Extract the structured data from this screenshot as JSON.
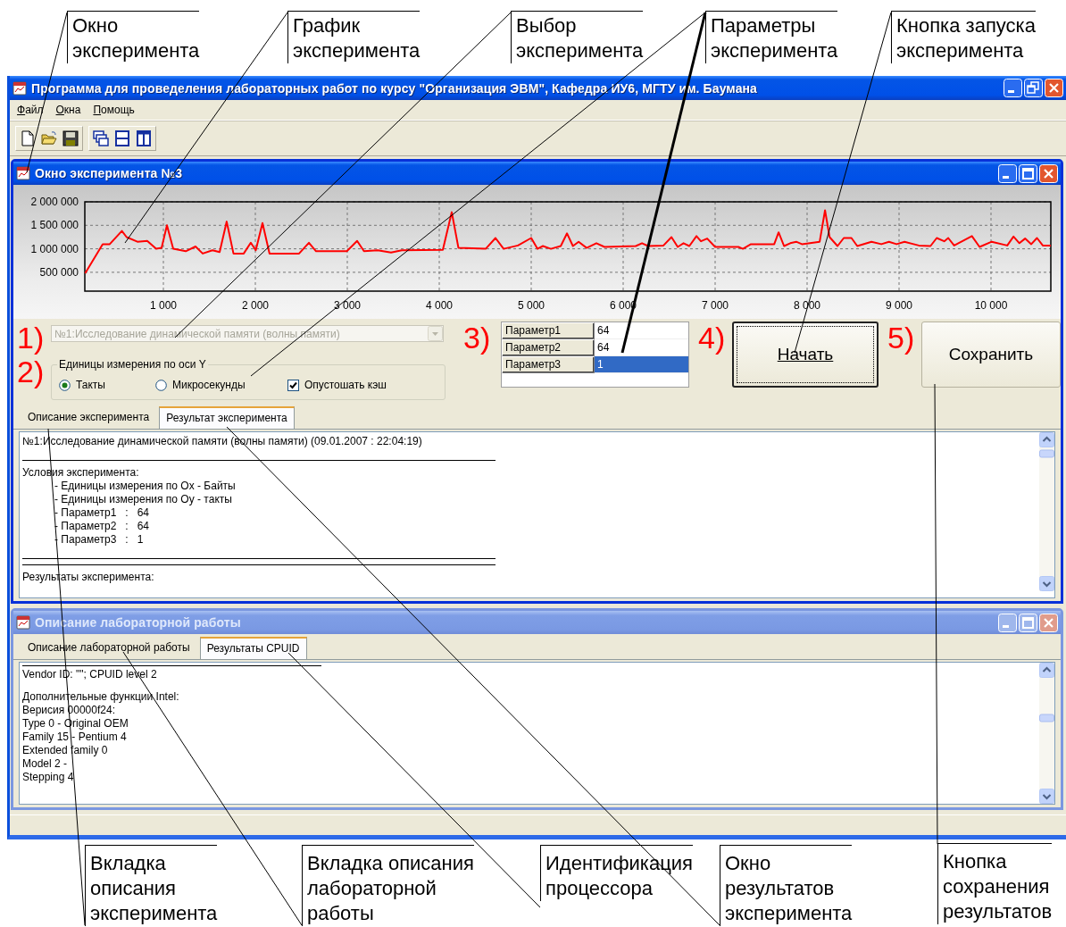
{
  "callouts_top": [
    {
      "text": "Окно\nэксперимента"
    },
    {
      "text": "График\nэксперимента"
    },
    {
      "text": "Выбор\nэксперимента"
    },
    {
      "text": "Параметры\nэксперимента"
    },
    {
      "text": "Кнопка запуска\nэксперимента"
    }
  ],
  "window": {
    "title": "Программа для проведеления лабораторных работ по курсу \"Организация ЭВМ\", Кафедра ИУ6, МГТУ им. Баумана",
    "active": true
  },
  "menu": [
    {
      "label": "Файл",
      "mnemonic": true
    },
    {
      "label": "Окна",
      "mnemonic": true
    },
    {
      "label": "Помощь",
      "mnemonic": true
    }
  ],
  "experiment_window": {
    "title": "Окно эксперимента №3",
    "active": true,
    "chart_data": {
      "type": "line",
      "grid": true,
      "xlim": [
        146,
        10650
      ],
      "ylim": [
        100000,
        2000000
      ],
      "xticks": [
        {
          "value": 1000,
          "label": "1 000"
        },
        {
          "value": 2000,
          "label": "2 000"
        },
        {
          "value": 3000,
          "label": "3 000"
        },
        {
          "value": 4000,
          "label": "4 000"
        },
        {
          "value": 5000,
          "label": "5 000"
        },
        {
          "value": 6000,
          "label": "6 000"
        },
        {
          "value": 7000,
          "label": "7 000"
        },
        {
          "value": 8000,
          "label": "8 000"
        },
        {
          "value": 9000,
          "label": "9 000"
        },
        {
          "value": 10000,
          "label": "10 000"
        }
      ],
      "yticks": [
        {
          "value": 500000,
          "label": "500 000"
        },
        {
          "value": 1000000,
          "label": "1 000 000"
        },
        {
          "value": 1500000,
          "label": "1 500 000"
        },
        {
          "value": 2000000,
          "label": "2 000 000"
        }
      ],
      "x": [
        150,
        340,
        417,
        549,
        600,
        718,
        825,
        922,
        981,
        1039,
        1107,
        1243,
        1350,
        1427,
        1534,
        1612,
        1689,
        1762,
        1874,
        1951,
        2005,
        2078,
        2155,
        2359,
        2476,
        2583,
        2660,
        2995,
        3107,
        3182,
        3330,
        3476,
        3592,
        4039,
        4136,
        4209,
        4505,
        4612,
        4700,
        4855,
        5000,
        5068,
        5127,
        5214,
        5321,
        5389,
        5453,
        5515,
        5603,
        5709,
        5797,
        6137,
        6205,
        6272,
        6438,
        6525,
        6593,
        6656,
        6719,
        6797,
        6845,
        6913,
        7000,
        7253,
        7302,
        7389,
        7642,
        7690,
        7749,
        7817,
        7881,
        7943,
        8137,
        8195,
        8244,
        8331,
        8399,
        8482,
        8545,
        8700,
        8807,
        8890,
        8972,
        9060,
        9215,
        9341,
        9409,
        9491,
        9535,
        9599,
        9792,
        9875,
        10007,
        10176,
        10244,
        10308,
        10370,
        10437,
        10500,
        10563,
        10650
      ],
      "series": [
        {
          "color": "#ff0000",
          "values": [
            480000,
            1100000,
            1100000,
            1380000,
            1250000,
            1150000,
            1170000,
            1000000,
            1020000,
            1500000,
            1000000,
            950000,
            1050000,
            900000,
            970000,
            930000,
            1580000,
            900000,
            900000,
            1130000,
            970000,
            1550000,
            900000,
            900000,
            900000,
            1130000,
            950000,
            950000,
            1170000,
            950000,
            970000,
            920000,
            970000,
            980000,
            1780000,
            1020000,
            1000000,
            1230000,
            1000000,
            1070000,
            1230000,
            1000000,
            1060000,
            1000000,
            1060000,
            1330000,
            1060000,
            1150000,
            1020000,
            1120000,
            1040000,
            1060000,
            1120000,
            1060000,
            1070000,
            1250000,
            1040000,
            1120000,
            1060000,
            1270000,
            1160000,
            1220000,
            1040000,
            1040000,
            1000000,
            1100000,
            1100000,
            1350000,
            1060000,
            1120000,
            1150000,
            1100000,
            1150000,
            1820000,
            1250000,
            1060000,
            1230000,
            1230000,
            1060000,
            1150000,
            1100000,
            1150000,
            1100000,
            1150000,
            1070000,
            1060000,
            1230000,
            1160000,
            1230000,
            1070000,
            1270000,
            1040000,
            1150000,
            1070000,
            1260000,
            1120000,
            1220000,
            1100000,
            1230000,
            1070000,
            1070000
          ]
        }
      ]
    },
    "markers": [
      "1)",
      "2)",
      "3)",
      "4)",
      "5)"
    ],
    "experiment_select": {
      "value": "№1:Исследование динамической памяти (волны памяти)",
      "disabled": true
    },
    "units_group": {
      "title": "Единицы измерения по оси Y",
      "options": [
        {
          "label": "Такты",
          "selected": true
        },
        {
          "label": "Микросекунды",
          "selected": false
        }
      ]
    },
    "clear_cache": {
      "label": "Опустошать кэш",
      "checked": true
    },
    "parameters": [
      {
        "name": "Параметр1",
        "value": "64",
        "selected": false
      },
      {
        "name": "Параметр2",
        "value": "64",
        "selected": false
      },
      {
        "name": "Параметр3",
        "value": "1",
        "selected": true
      }
    ],
    "start_button": {
      "label": "Начать",
      "default": true
    },
    "save_button": {
      "label": "Сохранить",
      "default": false
    },
    "tabs": [
      {
        "label": "Описание эксперимента",
        "selected": false
      },
      {
        "label": "Результат эксперимента",
        "selected": true
      }
    ],
    "text_lines": [
      {
        "kind": "text",
        "text": "№1:Исследование динамической памяти (волны памяти) (09.01.2007 : 22:04:19)"
      },
      {
        "kind": "gap"
      },
      {
        "kind": "rule"
      },
      {
        "kind": "text",
        "text": "Условия эксперимента:"
      },
      {
        "kind": "item",
        "text": "- Единицы измерения по Ox - Байты"
      },
      {
        "kind": "item",
        "text": "- Единицы измерения по Oy - такты"
      },
      {
        "kind": "item",
        "text": "- Параметр1   :   64"
      },
      {
        "kind": "item",
        "text": "- Параметр2   :   64"
      },
      {
        "kind": "item",
        "text": "- Параметр3   :   1"
      },
      {
        "kind": "gap"
      },
      {
        "kind": "rule"
      },
      {
        "kind": "rule"
      },
      {
        "kind": "text",
        "text": "Результаты эксперимента:"
      }
    ]
  },
  "lab_window": {
    "title": "Описание лабораторной работы",
    "active": false,
    "tabs": [
      {
        "label": "Описание лабораторной работы",
        "selected": false
      },
      {
        "label": "Результаты CPUID",
        "selected": true
      }
    ],
    "text_lines": [
      {
        "kind": "rule"
      },
      {
        "kind": "text",
        "text": "Vendor ID: \"\"; CPUID level 2"
      },
      {
        "kind": "gap"
      },
      {
        "kind": "text",
        "text": "Дополнительные функции Intel:"
      },
      {
        "kind": "text",
        "text": "Верисия 00000f24:"
      },
      {
        "kind": "text",
        "text": "Type 0 - Original OEM"
      },
      {
        "kind": "text",
        "text": "Family 15 - Pentium 4"
      },
      {
        "kind": "text",
        "text": "Extended family 0"
      },
      {
        "kind": "text",
        "text": "Model 2 -"
      },
      {
        "kind": "text",
        "text": "Stepping 4"
      }
    ]
  },
  "callouts_bottom": [
    {
      "text": "Вкладка\nописания\nэксперимента"
    },
    {
      "text": "Вкладка описания\nлабораторной\nработы"
    },
    {
      "text": "Идентификация\nпроцессора"
    },
    {
      "text": "Окно\nрезультатов\nэксперимента"
    },
    {
      "text": "Кнопка\nсохранения\nрезультатов"
    }
  ]
}
